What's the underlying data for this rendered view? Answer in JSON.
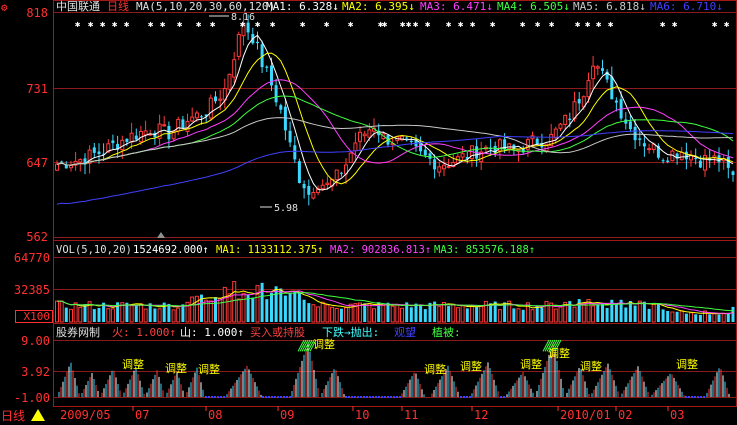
{
  "header": {
    "stock_name": "中国联通",
    "period": "日线",
    "ma_params": "MA(5,10,20,30,60,120)",
    "ma_items": [
      {
        "label": "MA1: 6.328↓",
        "color": "#ffffff"
      },
      {
        "label": "MA2: 6.395↓",
        "color": "#ffff00"
      },
      {
        "label": "MA3: 6.471↓",
        "color": "#ff40ff"
      },
      {
        "label": "MA4: 6.505↓",
        "color": "#40ff40"
      },
      {
        "label": "MA5: 6.818↓",
        "color": "#c8c8c8"
      },
      {
        "label": "MA6: 6.710↓",
        "color": "#4040ff"
      }
    ]
  },
  "price_axis": {
    "labels": [
      "818",
      "731",
      "647",
      "562"
    ]
  },
  "annotations": {
    "high": "8.16",
    "low": "5.98"
  },
  "volume_header": {
    "label": "VOL(5,10,20)",
    "items": [
      {
        "label": "1524692.000↑",
        "color": "#ffffff"
      },
      {
        "label": "MA1: 1133112.375↑",
        "color": "#ffff00"
      },
      {
        "label": "MA2: 902836.813↑",
        "color": "#ff40ff"
      },
      {
        "label": "MA3: 853576.188↑",
        "color": "#40ff40"
      }
    ]
  },
  "volume_axis": {
    "labels": [
      "64770",
      "32385",
      "X100"
    ]
  },
  "indicator_header": {
    "label": "股券网制",
    "items": [
      {
        "label": "火: 1.000↑",
        "color": "#ff4040"
      },
      {
        "label": "山: 1.000↑",
        "color": "#ffffff"
      },
      {
        "label": "买入或持股",
        "color": "#ff4040"
      },
      {
        "label": "下跌→抛出:",
        "color": "#40ffff"
      },
      {
        "label": "观望",
        "color": "#4040ff"
      },
      {
        "label": "植被:",
        "color": "#40ff40"
      }
    ]
  },
  "indicator_axis": {
    "labels": [
      "9.00",
      "3.92",
      "-1.00"
    ]
  },
  "indicator_labels": {
    "adjust": "调整"
  },
  "time_axis": {
    "labels": [
      "2009/05",
      "07",
      "08",
      "09",
      "10",
      "11",
      "12",
      "2010/01",
      "02",
      "03"
    ]
  },
  "footer": {
    "period_tab": "日线"
  },
  "chart_data": {
    "type": "candlestick",
    "price_range": [
      562,
      818
    ],
    "price_ticks": [
      562,
      647,
      731,
      818
    ],
    "high_point": 8.16,
    "low_point": 5.98,
    "series": [
      {
        "name": "MA1",
        "color": "#ffffff",
        "current": 6.328
      },
      {
        "name": "MA2",
        "color": "#ffff00",
        "current": 6.395
      },
      {
        "name": "MA3",
        "color": "#ff40ff",
        "current": 6.471
      },
      {
        "name": "MA4",
        "color": "#40ff40",
        "current": 6.505
      },
      {
        "name": "MA5",
        "color": "#c8c8c8",
        "current": 6.818
      },
      {
        "name": "MA6",
        "color": "#4040ff",
        "current": 6.71
      }
    ],
    "volume": {
      "range": [
        0,
        64770
      ],
      "ticks": [
        32385,
        64770
      ],
      "current": 1524692,
      "ma": [
        1133112.375,
        902836.813,
        853576.188
      ]
    },
    "indicator": {
      "range": [
        -1,
        9
      ],
      "ticks": [
        -1,
        3.92,
        9
      ]
    },
    "price_path": [
      [
        0,
        6.45
      ],
      [
        5,
        6.5
      ],
      [
        10,
        6.6
      ],
      [
        15,
        6.75
      ],
      [
        20,
        6.85
      ],
      [
        24,
        6.8
      ],
      [
        28,
        6.95
      ],
      [
        32,
        7.05
      ],
      [
        36,
        7.3
      ],
      [
        38,
        7.7
      ],
      [
        40,
        8.05
      ],
      [
        42,
        7.9
      ],
      [
        44,
        7.6
      ],
      [
        46,
        7.35
      ],
      [
        48,
        7.05
      ],
      [
        50,
        6.65
      ],
      [
        52,
        6.3
      ],
      [
        54,
        6.15
      ],
      [
        56,
        6.25
      ],
      [
        58,
        6.2
      ],
      [
        60,
        6.3
      ],
      [
        62,
        6.45
      ],
      [
        64,
        6.7
      ],
      [
        66,
        6.8
      ],
      [
        68,
        6.9
      ],
      [
        70,
        6.75
      ],
      [
        74,
        6.7
      ],
      [
        78,
        6.55
      ],
      [
        82,
        6.45
      ],
      [
        86,
        6.5
      ],
      [
        90,
        6.6
      ],
      [
        94,
        6.65
      ],
      [
        98,
        6.6
      ],
      [
        102,
        6.7
      ],
      [
        106,
        6.75
      ],
      [
        110,
        7.0
      ],
      [
        113,
        7.3
      ],
      [
        115,
        7.65
      ],
      [
        117,
        7.45
      ],
      [
        120,
        7.15
      ],
      [
        123,
        6.85
      ],
      [
        126,
        6.7
      ],
      [
        130,
        6.55
      ],
      [
        134,
        6.6
      ],
      [
        138,
        6.5
      ],
      [
        142,
        6.5
      ],
      [
        145,
        6.3
      ]
    ]
  }
}
